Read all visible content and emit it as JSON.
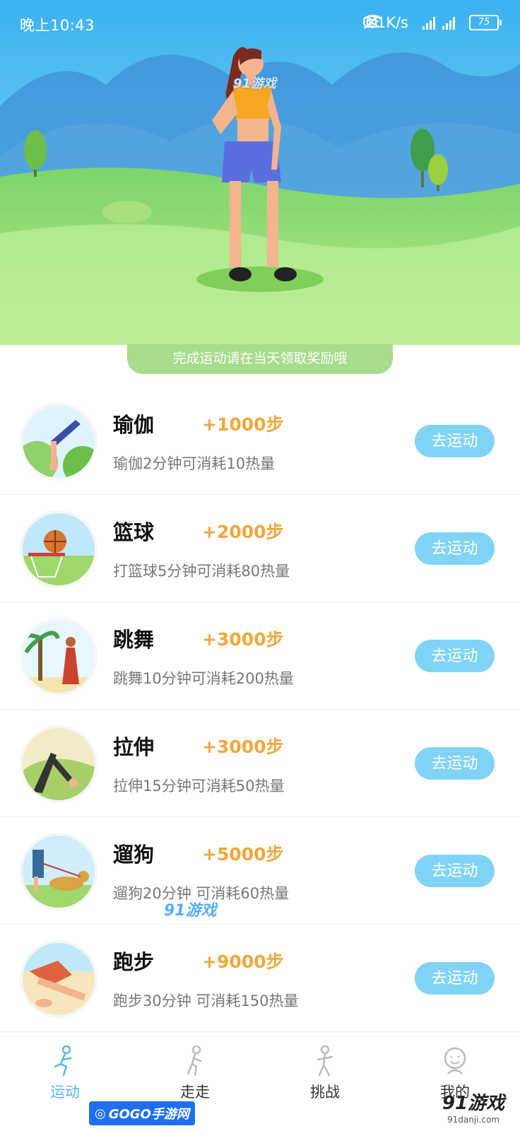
{
  "status_bar": {
    "time": "晚上10:43",
    "net_speed": "0.1K/s",
    "hd_badge": "HD",
    "battery": "75"
  },
  "hero": {
    "watermark": "91游戏"
  },
  "notice": "完成运动请在当天领取奖励哦",
  "activities": [
    {
      "name": "瑜伽",
      "reward": "+1000步",
      "desc": "瑜伽2分钟可消耗10热量",
      "button": "去运动",
      "icon": "yoga-icon"
    },
    {
      "name": "篮球",
      "reward": "+2000步",
      "desc": "打篮球5分钟可消耗80热量",
      "button": "去运动",
      "icon": "basketball-icon"
    },
    {
      "name": "跳舞",
      "reward": "+3000步",
      "desc": "跳舞10分钟可消耗200热量",
      "button": "去运动",
      "icon": "dance-icon"
    },
    {
      "name": "拉伸",
      "reward": "+3000步",
      "desc": "拉伸15分钟可消耗50热量",
      "button": "去运动",
      "icon": "stretch-icon"
    },
    {
      "name": "遛狗",
      "reward": "+5000步",
      "desc": "遛狗20分钟 可消耗60热量",
      "button": "去运动",
      "icon": "dog-walk-icon"
    },
    {
      "name": "跑步",
      "reward": "+9000步",
      "desc": "跑步30分钟 可消耗150热量",
      "button": "去运动",
      "icon": "running-icon"
    }
  ],
  "watermark_mid": "91游戏",
  "tabs": [
    {
      "label": "运动",
      "icon": "running-person-icon",
      "active": true
    },
    {
      "label": "走走",
      "icon": "walking-person-icon",
      "active": false
    },
    {
      "label": "挑战",
      "icon": "challenge-person-icon",
      "active": false
    },
    {
      "label": "我的",
      "icon": "profile-face-icon",
      "active": false
    }
  ],
  "footer_watermarks": {
    "gogo": "GOGO手游网",
    "brand": "91游戏",
    "brand_url": "91danji.com"
  },
  "colors": {
    "accent_blue": "#80d3f5",
    "reward_orange": "#f0a73a",
    "notice_green": "#a6dc8b",
    "tab_active": "#59b7ef"
  }
}
